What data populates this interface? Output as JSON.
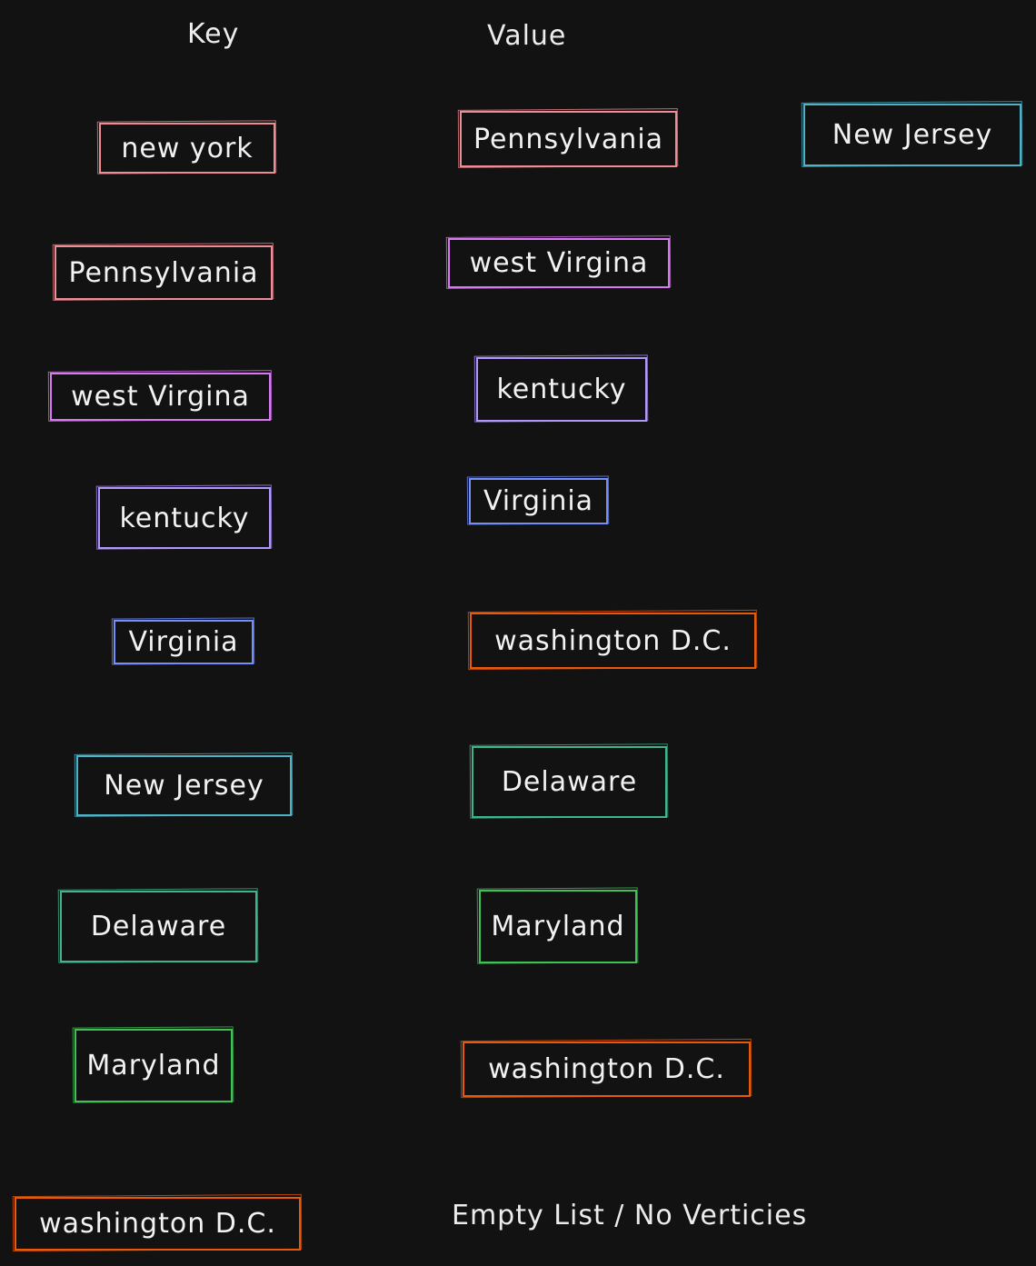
{
  "headers": {
    "key": "Key",
    "value": "Value"
  },
  "colors": {
    "new_york": "#f08c96",
    "pennsylvania": "#f08c96",
    "west_virgina": "#da77f2",
    "kentucky": "#b197fc",
    "virginia": "#748ffc",
    "new_jersey": "#4fb3c7",
    "delaware": "#3fb58c",
    "maryland": "#40c057",
    "washington_dc": "#e8590c"
  },
  "keys": [
    {
      "label": "new york",
      "color": "#f08c96"
    },
    {
      "label": "Pennsylvania",
      "color": "#f08c96"
    },
    {
      "label": "west Virgina",
      "color": "#da77f2"
    },
    {
      "label": "kentucky",
      "color": "#b197fc"
    },
    {
      "label": "Virginia",
      "color": "#748ffc"
    },
    {
      "label": "New Jersey",
      "color": "#4fb3c7"
    },
    {
      "label": "Delaware",
      "color": "#3fb58c"
    },
    {
      "label": "Maryland",
      "color": "#40c057"
    },
    {
      "label": "washington D.C.",
      "color": "#e8590c"
    }
  ],
  "values": [
    {
      "label": "Pennsylvania",
      "color": "#f08c96"
    },
    {
      "label": "west Virgina",
      "color": "#da77f2"
    },
    {
      "label": "kentucky",
      "color": "#b197fc"
    },
    {
      "label": "Virginia",
      "color": "#748ffc"
    },
    {
      "label": "washington D.C.",
      "color": "#e8590c"
    },
    {
      "label": "Delaware",
      "color": "#3fb58c"
    },
    {
      "label": "Maryland",
      "color": "#40c057"
    },
    {
      "label": "washington D.C.",
      "color": "#e8590c"
    }
  ],
  "extra_value": {
    "label": "New Jersey",
    "color": "#4fb3c7"
  },
  "empty_text": "Empty List / No Verticies"
}
